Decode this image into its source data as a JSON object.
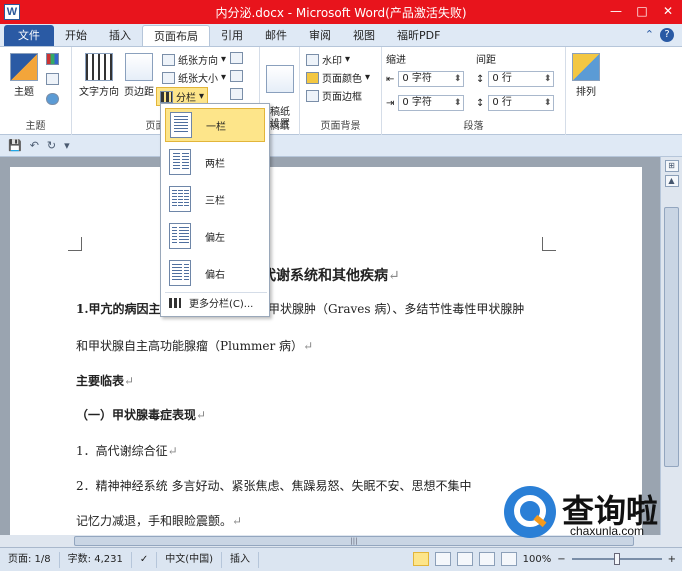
{
  "titlebar": {
    "title": "内分泌.docx - Microsoft Word(产品激活失败)",
    "app_icon": "W",
    "min": "—",
    "max": "□",
    "close": "✕"
  },
  "tabs": {
    "file": "文件",
    "items": [
      "开始",
      "插入",
      "页面布局",
      "引用",
      "邮件",
      "审阅",
      "视图",
      "福昕PDF"
    ],
    "active": "页面布局",
    "help": "?"
  },
  "ribbon": {
    "theme_group": {
      "label": "主题",
      "theme_btn": "主题"
    },
    "page_setup": {
      "label": "页面设置",
      "text_direction": "文字方向",
      "margins": "页边距",
      "orientation": "纸张方向",
      "size": "纸张大小",
      "columns": "分栏"
    },
    "paper": {
      "label": "稿纸",
      "btn": "稿纸\n设置"
    },
    "background": {
      "label": "页面背景",
      "watermark": "水印",
      "page_color": "页面颜色",
      "page_borders": "页面边框"
    },
    "paragraph": {
      "label": "段落",
      "indent_title": "缩进",
      "spacing_title": "间距",
      "indent_left": "0 字符",
      "indent_right": "0 字符",
      "space_before": "0 行",
      "space_after": "0 行"
    },
    "arrange": {
      "label": "排列",
      "btn": "排列"
    }
  },
  "columns_menu": {
    "items": [
      "一栏",
      "两栏",
      "三栏",
      "偏左",
      "偏右"
    ],
    "more": "更多分栏(C)..."
  },
  "document": {
    "heading": "代谢系统和其他疾病",
    "lines": [
      "1.甲亢的病因主",
      "甲状腺肿（Graves 病）、多结节性毒性甲状腺肿",
      "和甲状腺自主高功能腺瘤（Plummer 病）",
      "主要临表",
      "（一）甲状腺毒症表现",
      "1．高代谢综合征",
      "2．精神神经系统  多言好动、紧张焦虑、焦躁易怒、失眠不安、思想不集中",
      "记忆力减退，手和眼睑震颤。"
    ],
    "para_mark": "↵"
  },
  "statusbar": {
    "page": "页面: 1/8",
    "words": "字数: 4,231",
    "lang": "中文(中国)",
    "mode": "插入",
    "zoom": "100%",
    "minus": "−",
    "plus": "+"
  },
  "watermark": {
    "name": "查询啦",
    "url": "chaxunla.com"
  }
}
